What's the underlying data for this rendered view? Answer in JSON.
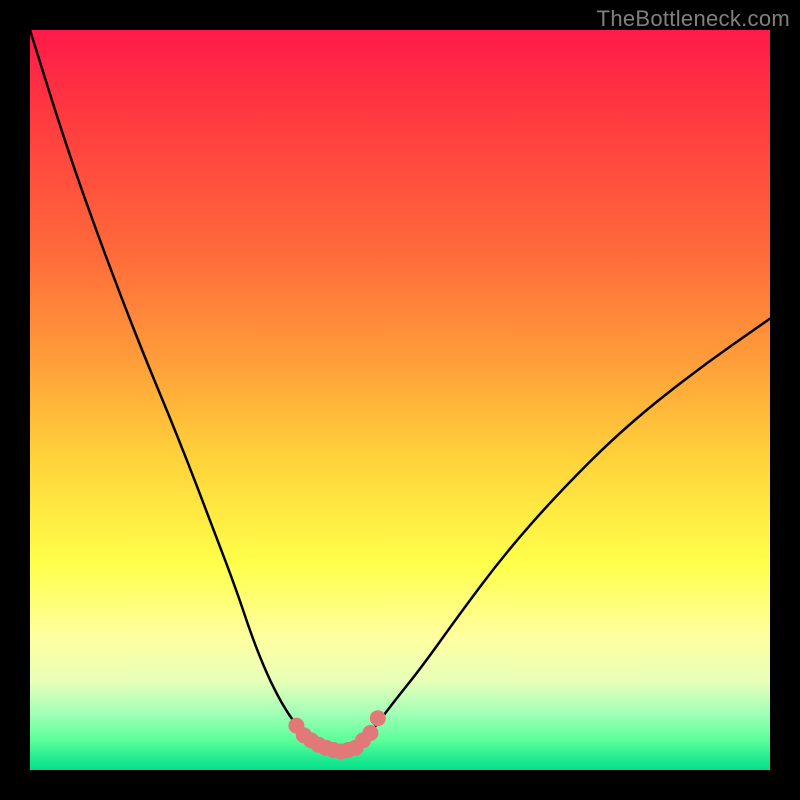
{
  "watermark": "TheBottleneck.com",
  "chart_data": {
    "type": "line",
    "title": "",
    "xlabel": "",
    "ylabel": "",
    "xlim": [
      0,
      100
    ],
    "ylim": [
      0,
      100
    ],
    "series": [
      {
        "name": "curve",
        "x": [
          0,
          5,
          10,
          15,
          20,
          25,
          28,
          30,
          32,
          34,
          36,
          38,
          40,
          42,
          44,
          46,
          49,
          53,
          58,
          64,
          71,
          80,
          90,
          100
        ],
        "y": [
          100,
          84,
          70,
          57,
          45,
          32,
          24,
          18,
          13,
          9,
          6,
          4,
          3,
          2.5,
          3,
          5,
          9,
          14,
          21,
          29,
          37,
          46,
          54,
          61
        ]
      }
    ],
    "markers": {
      "name": "highlight-points",
      "color": "#e27878",
      "x": [
        36,
        37,
        38,
        39,
        40,
        41,
        42,
        43,
        44,
        45,
        46,
        47
      ],
      "y": [
        6,
        4.7,
        4,
        3.4,
        3.0,
        2.7,
        2.5,
        2.7,
        3.0,
        4.0,
        5.0,
        7.0
      ]
    }
  }
}
